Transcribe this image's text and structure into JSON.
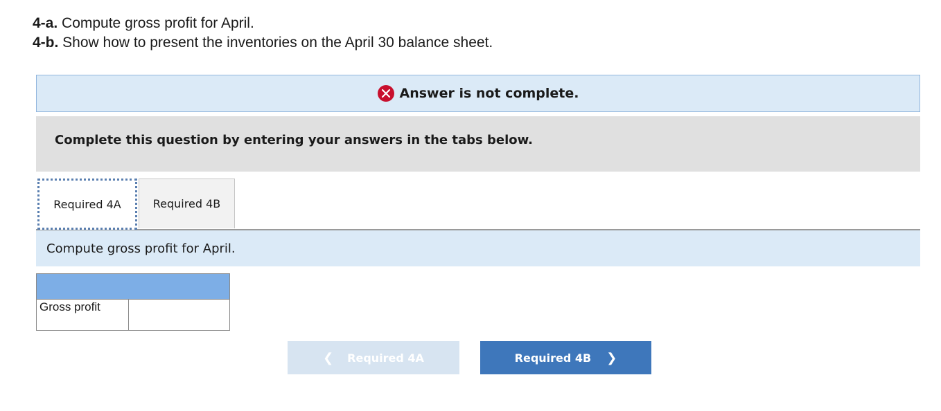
{
  "questions": [
    {
      "num": "4-a.",
      "text": " Compute gross profit for April."
    },
    {
      "num": "4-b.",
      "text": " Show how to present the inventories on the April 30 balance sheet."
    }
  ],
  "alert": {
    "icon": "x-circle-icon",
    "text": "Answer is not complete.",
    "color": "#c8102e"
  },
  "instructions": "Complete this question by entering your answers in the tabs below.",
  "tabs": [
    {
      "label": "Required 4A",
      "active": true
    },
    {
      "label": "Required 4B",
      "active": false
    }
  ],
  "tab_panel": {
    "prompt": "Compute gross profit for April."
  },
  "table": {
    "rows": [
      {
        "label": "Gross profit",
        "value": ""
      }
    ]
  },
  "nav": {
    "prev_label": "Required 4A",
    "next_label": "Required 4B",
    "prev_icon": "chevron-left-icon",
    "next_icon": "chevron-right-icon"
  }
}
